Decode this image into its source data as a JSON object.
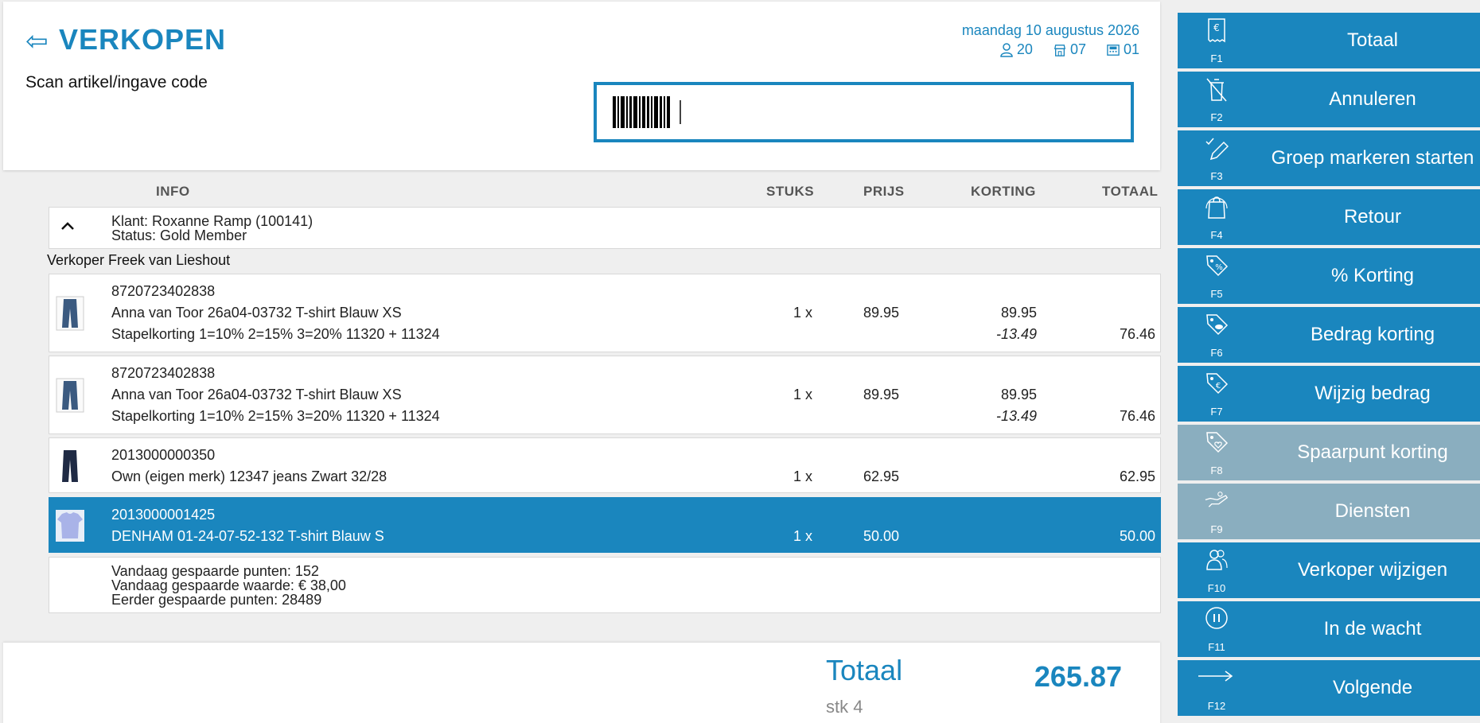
{
  "header": {
    "back_icon": "back-arrow-icon",
    "title": "VERKOPEN",
    "scan_label": "Scan artikel/ingave code",
    "date": "maandag 10 augustus 2026",
    "user_id": "20",
    "store_id": "07",
    "register_id": "01"
  },
  "table": {
    "headers": {
      "info": "INFO",
      "stuks": "STUKS",
      "prijs": "PRIJS",
      "korting": "KORTING",
      "totaal": "TOTAAL"
    },
    "customer": {
      "name": "Klant: Roxanne Ramp (100141)",
      "status": "Status: Gold Member"
    },
    "salesperson": "Verkoper Freek van Lieshout",
    "items": [
      {
        "code": "8720723402838",
        "description": "Anna van Toor 26a04-03732 T-shirt Blauw XS",
        "discount_note": "Stapelkorting 1=10% 2=15% 3=20% 11320 + 11324",
        "qty": "1 x",
        "price": "89.95",
        "korting_price": "89.95",
        "korting_amount": "-13.49",
        "total": "76.46",
        "thumb": "jeans-thumbnail"
      },
      {
        "code": "8720723402838",
        "description": "Anna van Toor 26a04-03732 T-shirt Blauw XS",
        "discount_note": "Stapelkorting 1=10% 2=15% 3=20% 11320 + 11324",
        "qty": "1 x",
        "price": "89.95",
        "korting_price": "89.95",
        "korting_amount": "-13.49",
        "total": "76.46",
        "thumb": "jeans-thumbnail"
      },
      {
        "code": "2013000000350",
        "description": "Own (eigen merk) 12347 jeans Zwart 32/28",
        "qty": "1 x",
        "price": "62.95",
        "total": "62.95",
        "thumb": "dark-jeans-thumbnail"
      },
      {
        "code": "2013000001425",
        "description": "DENHAM 01-24-07-52-132 T-shirt Blauw S",
        "qty": "1 x",
        "price": "50.00",
        "total": "50.00",
        "thumb": "tshirt-thumbnail",
        "selected": true
      }
    ],
    "points": {
      "today_points": "Vandaag gespaarde punten: 152",
      "today_value": "Vandaag gespaarde waarde: € 38,00",
      "earlier_points": "Eerder gespaarde punten: 28489"
    }
  },
  "footer": {
    "total_label": "Totaal",
    "total_value": "265.87",
    "count": "stk 4"
  },
  "function_keys": [
    {
      "key": "F1",
      "label": "Totaal",
      "icon": "receipt-euro-icon",
      "enabled": true
    },
    {
      "key": "F2",
      "label": "Annuleren",
      "icon": "trash-cancel-icon",
      "enabled": true
    },
    {
      "key": "F3",
      "label": "Groep markeren starten",
      "icon": "pencil-check-icon",
      "enabled": true
    },
    {
      "key": "F4",
      "label": "Retour",
      "icon": "bag-return-icon",
      "enabled": true
    },
    {
      "key": "F5",
      "label": "% Korting",
      "icon": "tag-percent-icon",
      "enabled": true
    },
    {
      "key": "F6",
      "label": "Bedrag korting",
      "icon": "tag-coin-icon",
      "enabled": true
    },
    {
      "key": "F7",
      "label": "Wijzig bedrag",
      "icon": "tag-euro-icon",
      "enabled": true
    },
    {
      "key": "F8",
      "label": "Spaarpunt korting",
      "icon": "tag-heart-icon",
      "enabled": false
    },
    {
      "key": "F9",
      "label": "Diensten",
      "icon": "hand-service-icon",
      "enabled": false
    },
    {
      "key": "F10",
      "label": "Verkoper wijzigen",
      "icon": "users-icon",
      "enabled": true
    },
    {
      "key": "F11",
      "label": "In de wacht",
      "icon": "pause-icon",
      "enabled": true
    },
    {
      "key": "F12",
      "label": "Volgende",
      "icon": "arrow-right-icon",
      "enabled": true
    }
  ],
  "colors": {
    "accent": "#1a86be",
    "disabled": "#8aaebf",
    "background": "#efefef"
  }
}
